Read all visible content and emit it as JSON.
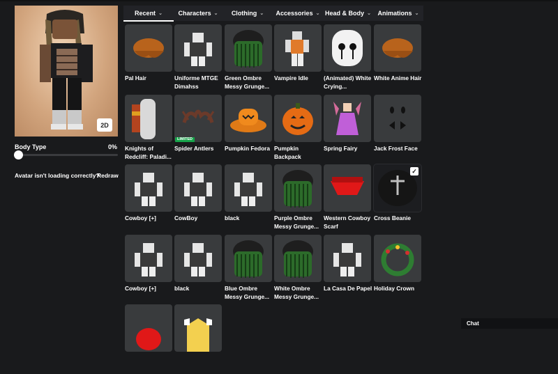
{
  "colors": {
    "background": "#191a1c",
    "tile": "#393b3d",
    "tabbar": "#222327",
    "limited": "#17a34a"
  },
  "avatar": {
    "toggle_label": "2D"
  },
  "body_type": {
    "label": "Body Type",
    "value": "0%"
  },
  "loading": {
    "message": "Avatar isn't loading correctly?",
    "redraw": "Redraw"
  },
  "tabs": [
    {
      "label": "Recent",
      "icon": "chevron-down-icon"
    },
    {
      "label": "Characters",
      "icon": "chevron-down-icon"
    },
    {
      "label": "Clothing",
      "icon": "chevron-down-icon"
    },
    {
      "label": "Accessories",
      "icon": "chevron-down-icon"
    },
    {
      "label": "Head & Body",
      "icon": "chevron-down-icon"
    },
    {
      "label": "Animations",
      "icon": "chevron-down-icon"
    }
  ],
  "items": [
    {
      "name": "Pal Hair",
      "icon": "hair"
    },
    {
      "name": "Uniforme MTGE Dimahss",
      "icon": "outfit"
    },
    {
      "name": "Green Ombre Messy Grunge...",
      "icon": "dreads"
    },
    {
      "name": "Vampire Idle",
      "icon": "animation"
    },
    {
      "name": "(Animated) White Crying...",
      "icon": "mask"
    },
    {
      "name": "White Anime Hair",
      "icon": "hair"
    },
    {
      "name": "Knights of Redcliff: Paladi...",
      "icon": "armor"
    },
    {
      "name": "Spider Antlers",
      "icon": "antlers",
      "badge": "LIMITED"
    },
    {
      "name": "Pumpkin Fedora",
      "icon": "hat"
    },
    {
      "name": "Pumpkin Backpack",
      "icon": "pumpkin"
    },
    {
      "name": "Spring Fairy",
      "icon": "fairy"
    },
    {
      "name": "Jack Frost Face",
      "icon": "face"
    },
    {
      "name": "Cowboy [+]",
      "icon": "outfit"
    },
    {
      "name": "CowBoy",
      "icon": "outfit"
    },
    {
      "name": "black",
      "icon": "outfit"
    },
    {
      "name": "Purple Ombre Messy Grunge...",
      "icon": "dreads"
    },
    {
      "name": "Western Cowboy Scarf",
      "icon": "scarf"
    },
    {
      "name": "Cross Beanie",
      "icon": "beanie",
      "selected": true
    },
    {
      "name": "Cowboy [+]",
      "icon": "outfit"
    },
    {
      "name": "black",
      "icon": "outfit"
    },
    {
      "name": "Blue Ombre Messy Grunge...",
      "icon": "dreads"
    },
    {
      "name": "White Ombre Messy Grunge...",
      "icon": "dreads"
    },
    {
      "name": "La Casa De Papel",
      "icon": "outfit"
    },
    {
      "name": "Holiday Crown",
      "icon": "crown"
    },
    {
      "name": "",
      "icon": "cap"
    },
    {
      "name": "",
      "icon": "shirt"
    }
  ],
  "chat": {
    "label": "Chat"
  }
}
